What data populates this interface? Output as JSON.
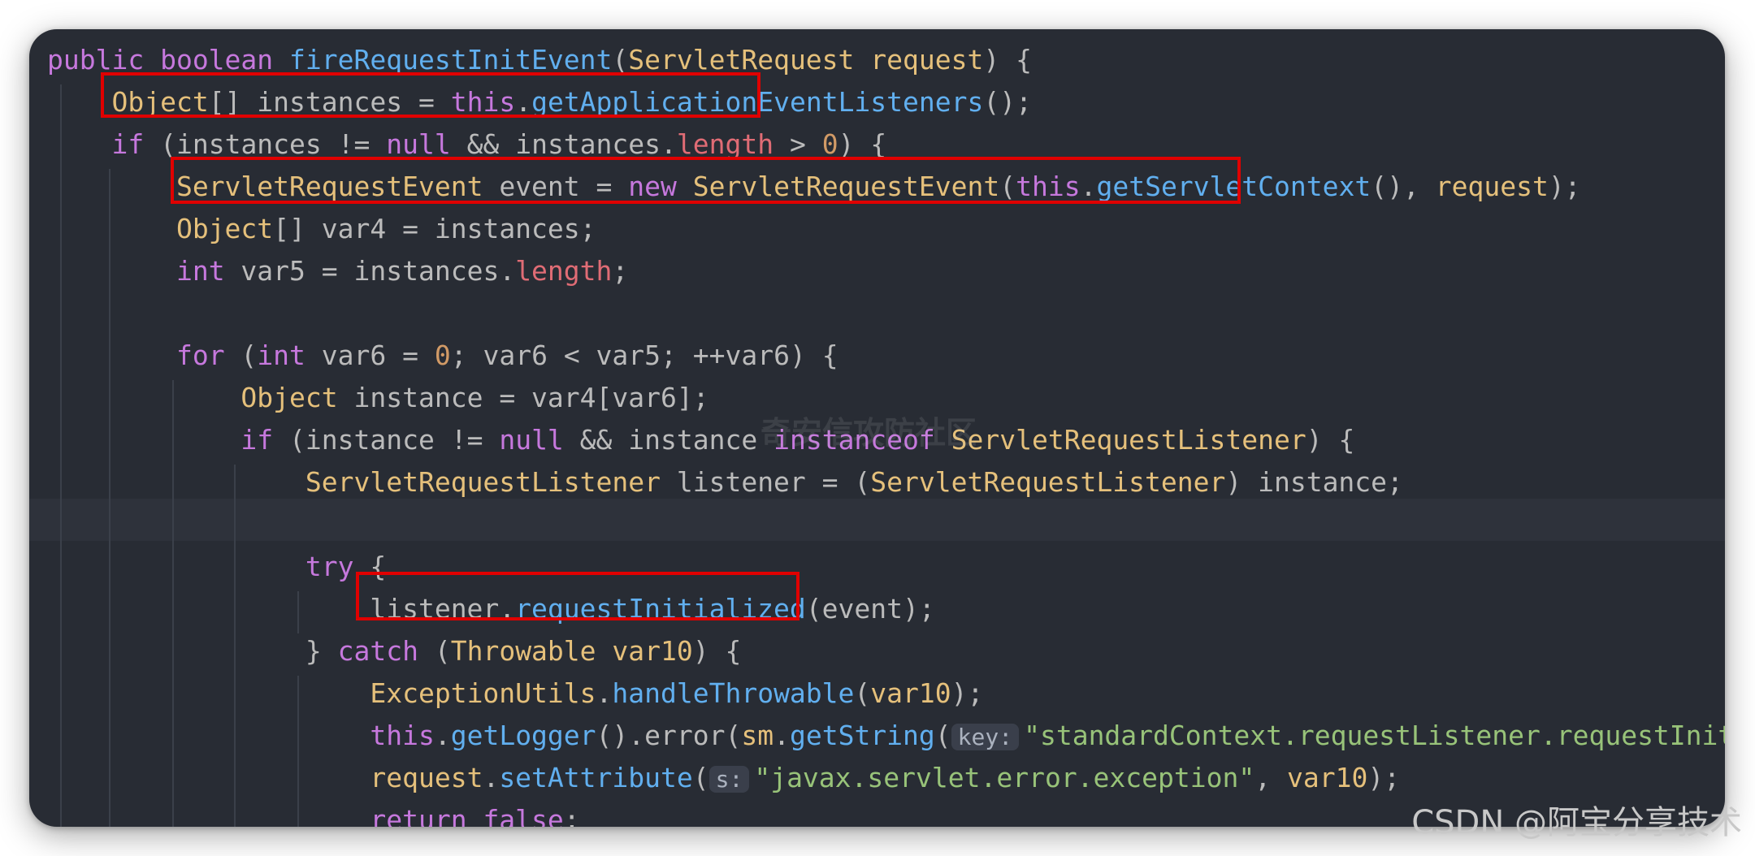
{
  "editor": {
    "lines": [
      [
        {
          "t": "public ",
          "c": "kw"
        },
        {
          "t": "boolean ",
          "c": "kw"
        },
        {
          "t": "fireRequestInitEvent",
          "c": "fn"
        },
        {
          "t": "("
        },
        {
          "t": "ServletRequest ",
          "c": "ty"
        },
        {
          "t": "request",
          "c": "pa"
        },
        {
          "t": ") {"
        }
      ],
      [
        {
          "t": "    "
        },
        {
          "t": "Object",
          "c": "ty"
        },
        {
          "t": "[] instances = "
        },
        {
          "t": "this",
          "c": "kw"
        },
        {
          "t": "."
        },
        {
          "t": "getApplicationEventListeners",
          "c": "fn"
        },
        {
          "t": "();"
        }
      ],
      [
        {
          "t": "    "
        },
        {
          "t": "if",
          "c": "kw"
        },
        {
          "t": " (instances != "
        },
        {
          "t": "null",
          "c": "kw"
        },
        {
          "t": " && instances."
        },
        {
          "t": "length",
          "c": "fd"
        },
        {
          "t": " > "
        },
        {
          "t": "0",
          "c": "nu"
        },
        {
          "t": ") {"
        }
      ],
      [
        {
          "t": "        "
        },
        {
          "t": "ServletRequestEvent",
          "c": "ty"
        },
        {
          "t": " event = "
        },
        {
          "t": "new ",
          "c": "kw"
        },
        {
          "t": "ServletRequestEvent",
          "c": "ty"
        },
        {
          "t": "("
        },
        {
          "t": "this",
          "c": "kw"
        },
        {
          "t": "."
        },
        {
          "t": "getServletContext",
          "c": "fn"
        },
        {
          "t": "(), "
        },
        {
          "t": "request",
          "c": "pa"
        },
        {
          "t": ");"
        }
      ],
      [
        {
          "t": "        "
        },
        {
          "t": "Object",
          "c": "ty"
        },
        {
          "t": "[] var4 = instances;"
        }
      ],
      [
        {
          "t": "        "
        },
        {
          "t": "int",
          "c": "kw"
        },
        {
          "t": " var5 = instances."
        },
        {
          "t": "length",
          "c": "fd"
        },
        {
          "t": ";"
        }
      ],
      [],
      [
        {
          "t": "        "
        },
        {
          "t": "for",
          "c": "kw"
        },
        {
          "t": " ("
        },
        {
          "t": "int",
          "c": "kw"
        },
        {
          "t": " var6 = "
        },
        {
          "t": "0",
          "c": "nu"
        },
        {
          "t": "; var6 < var5; ++var6) {"
        }
      ],
      [
        {
          "t": "            "
        },
        {
          "t": "Object",
          "c": "ty"
        },
        {
          "t": " instance = var4[var6];"
        }
      ],
      [
        {
          "t": "            "
        },
        {
          "t": "if",
          "c": "kw"
        },
        {
          "t": " (instance != "
        },
        {
          "t": "null",
          "c": "kw"
        },
        {
          "t": " && instance "
        },
        {
          "t": "instanceof ",
          "c": "kw"
        },
        {
          "t": "ServletRequestListener",
          "c": "ty"
        },
        {
          "t": ") {"
        }
      ],
      [
        {
          "t": "                "
        },
        {
          "t": "ServletRequestListener",
          "c": "ty"
        },
        {
          "t": " listener = ("
        },
        {
          "t": "ServletRequestListener",
          "c": "ty"
        },
        {
          "t": ") instance;"
        }
      ],
      [],
      [
        {
          "t": "                "
        },
        {
          "t": "try",
          "c": "kw"
        },
        {
          "t": " {"
        }
      ],
      [
        {
          "t": "                    listener."
        },
        {
          "t": "requestInitialized",
          "c": "fn"
        },
        {
          "t": "(event);"
        }
      ],
      [
        {
          "t": "                } "
        },
        {
          "t": "catch",
          "c": "kw"
        },
        {
          "t": " ("
        },
        {
          "t": "Throwable ",
          "c": "ty"
        },
        {
          "t": "var10",
          "c": "pa"
        },
        {
          "t": ") {"
        }
      ],
      [
        {
          "t": "                    "
        },
        {
          "t": "ExceptionUtils",
          "c": "ty"
        },
        {
          "t": "."
        },
        {
          "t": "handleThrowable",
          "c": "fn"
        },
        {
          "t": "("
        },
        {
          "t": "var10",
          "c": "pa"
        },
        {
          "t": ");"
        }
      ],
      [
        {
          "t": "                    "
        },
        {
          "t": "this",
          "c": "kw"
        },
        {
          "t": "."
        },
        {
          "t": "getLogger",
          "c": "fn"
        },
        {
          "t": "().error("
        },
        {
          "t": "sm",
          "c": "pa"
        },
        {
          "t": "."
        },
        {
          "t": "getString",
          "c": "fn"
        },
        {
          "t": "("
        },
        {
          "t": "key:",
          "c": "hint"
        },
        {
          "t": "\"standardContext.requestListener.requestInit",
          "c": "st"
        }
      ],
      [
        {
          "t": "                    "
        },
        {
          "t": "request",
          "c": "pa"
        },
        {
          "t": "."
        },
        {
          "t": "setAttribute",
          "c": "fn"
        },
        {
          "t": "("
        },
        {
          "t": "s:",
          "c": "hint"
        },
        {
          "t": "\"javax.servlet.error.exception\"",
          "c": "st"
        },
        {
          "t": ", "
        },
        {
          "t": "var10",
          "c": "pa"
        },
        {
          "t": ");"
        }
      ],
      [
        {
          "t": "                    "
        },
        {
          "t": "return ",
          "c": "kw"
        },
        {
          "t": "false",
          "c": "kw"
        },
        {
          "t": ";"
        }
      ]
    ],
    "watermark": "奇安信攻防社区",
    "credit": "CSDN @阿宝分享技术"
  }
}
